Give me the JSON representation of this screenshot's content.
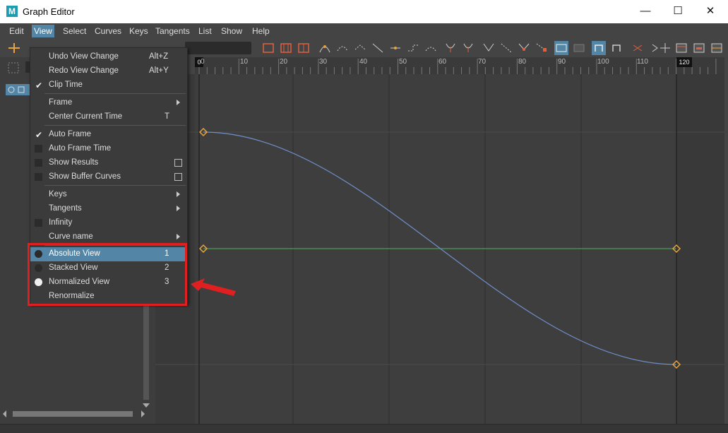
{
  "window": {
    "title": "Graph Editor",
    "app_icon_letter": "M"
  },
  "window_controls": {
    "minimize": "—",
    "maximize": "☐",
    "close": "✕"
  },
  "menubar": {
    "items": [
      "Edit",
      "View",
      "Select",
      "Curves",
      "Keys",
      "Tangents",
      "List",
      "Show",
      "Help"
    ],
    "active": "View"
  },
  "ruler": {
    "ticks": [
      "0",
      "10",
      "20",
      "30",
      "40",
      "50",
      "60",
      "70",
      "80",
      "90",
      "100",
      "110",
      "120"
    ],
    "start_marker": "0",
    "end_marker": "120"
  },
  "view_menu": {
    "undo_view_change": {
      "label": "Undo View Change",
      "shortcut": "Alt+Z"
    },
    "redo_view_change": {
      "label": "Redo View Change",
      "shortcut": "Alt+Y"
    },
    "clip_time": {
      "label": "Clip Time",
      "checked": true
    },
    "frame": {
      "label": "Frame"
    },
    "center_current_time": {
      "label": "Center Current Time",
      "shortcut": "T"
    },
    "auto_frame": {
      "label": "Auto Frame",
      "checked": true
    },
    "auto_frame_time": {
      "label": "Auto Frame Time"
    },
    "show_results": {
      "label": "Show Results"
    },
    "show_buffer_curves": {
      "label": "Show Buffer Curves"
    },
    "keys": {
      "label": "Keys"
    },
    "tangents": {
      "label": "Tangents"
    },
    "infinity": {
      "label": "Infinity"
    },
    "curve_name": {
      "label": "Curve name"
    },
    "absolute_view": {
      "label": "Absolute View",
      "shortcut": "1"
    },
    "stacked_view": {
      "label": "Stacked View",
      "shortcut": "2"
    },
    "normalized_view": {
      "label": "Normalized View",
      "shortcut": "3",
      "selected": true
    },
    "renormalize": {
      "label": "Renormalize"
    }
  },
  "colors": {
    "accent": "#5285a6",
    "annotation": "#e02020",
    "curve_blue": "#6f8fc9",
    "curve_green": "#4f9a57",
    "key": "#e8a33a"
  }
}
